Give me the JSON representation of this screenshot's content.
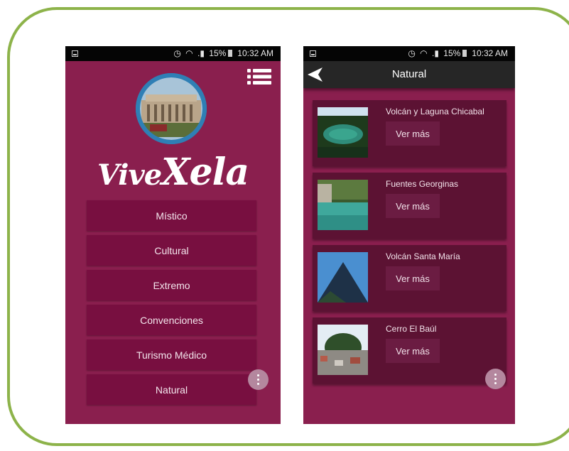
{
  "status_bar": {
    "battery": "15%",
    "time": "10:32 AM"
  },
  "home": {
    "brand": {
      "part1": "Vive",
      "part2": "Xela"
    },
    "categories": [
      {
        "label": "Místico"
      },
      {
        "label": "Cultural"
      },
      {
        "label": "Extremo"
      },
      {
        "label": "Convenciones"
      },
      {
        "label": "Turismo Médico"
      },
      {
        "label": "Natural"
      }
    ],
    "icons": [
      "menu-icon",
      "more-vert-icon"
    ]
  },
  "detail": {
    "title": "Natural",
    "places": [
      {
        "name": "Volcán y Laguna Chicabal",
        "button": "Ver más"
      },
      {
        "name": "Fuentes Georginas",
        "button": "Ver más"
      },
      {
        "name": "Volcán Santa María",
        "button": "Ver más"
      },
      {
        "name": "Cerro El Baúl",
        "button": "Ver más"
      }
    ],
    "icons": [
      "back-arrow-icon",
      "more-vert-icon"
    ]
  },
  "colors": {
    "frame_border": "#8db34a",
    "screen_bg": "#8a1f4e",
    "category_button": "#780f40",
    "card_bg": "#5c1233",
    "toolbar_bg": "#262626",
    "fab": "#b4879e"
  }
}
